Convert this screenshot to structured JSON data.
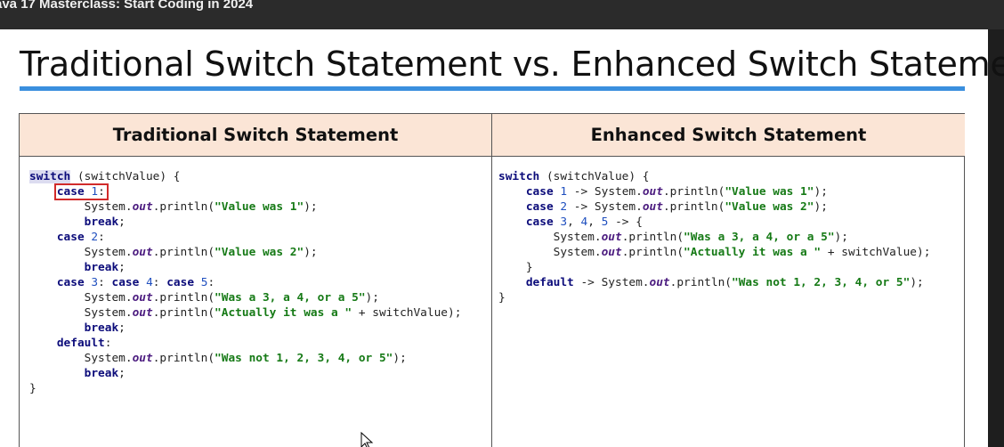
{
  "window": {
    "title": "ava 17 Masterclass: Start Coding in 2024"
  },
  "slide": {
    "title": "Traditional Switch Statement vs. Enhanced Switch Statement"
  },
  "table": {
    "left_header": "Traditional Switch Statement",
    "right_header": "Enhanced Switch Statement"
  },
  "traditional_code": [
    [
      [
        "switch",
        "kw hl-switch"
      ],
      [
        " (switchValue) {",
        ""
      ]
    ],
    [
      [
        "    ",
        ""
      ],
      [
        "case",
        "kw"
      ],
      [
        " ",
        ""
      ],
      [
        "1",
        "num"
      ],
      [
        ":",
        ""
      ]
    ],
    [
      [
        "        System.",
        ""
      ],
      [
        "out",
        "fld"
      ],
      [
        ".println(",
        ""
      ],
      [
        "\"Value was 1\"",
        "str"
      ],
      [
        ");",
        ""
      ]
    ],
    [
      [
        "        ",
        ""
      ],
      [
        "break",
        "kw"
      ],
      [
        ";",
        ""
      ]
    ],
    [
      [
        "    ",
        ""
      ],
      [
        "case",
        "kw"
      ],
      [
        " ",
        ""
      ],
      [
        "2",
        "num"
      ],
      [
        ":",
        ""
      ]
    ],
    [
      [
        "        System.",
        ""
      ],
      [
        "out",
        "fld"
      ],
      [
        ".println(",
        ""
      ],
      [
        "\"Value was 2\"",
        "str"
      ],
      [
        ");",
        ""
      ]
    ],
    [
      [
        "        ",
        ""
      ],
      [
        "break",
        "kw"
      ],
      [
        ";",
        ""
      ]
    ],
    [
      [
        "    ",
        ""
      ],
      [
        "case",
        "kw"
      ],
      [
        " ",
        ""
      ],
      [
        "3",
        "num"
      ],
      [
        ": ",
        ""
      ],
      [
        "case",
        "kw"
      ],
      [
        " ",
        ""
      ],
      [
        "4",
        "num"
      ],
      [
        ": ",
        ""
      ],
      [
        "case",
        "kw"
      ],
      [
        " ",
        ""
      ],
      [
        "5",
        "num"
      ],
      [
        ":",
        ""
      ]
    ],
    [
      [
        "        System.",
        ""
      ],
      [
        "out",
        "fld"
      ],
      [
        ".println(",
        ""
      ],
      [
        "\"Was a 3, a 4, or a 5\"",
        "str"
      ],
      [
        ");",
        ""
      ]
    ],
    [
      [
        "        System.",
        ""
      ],
      [
        "out",
        "fld"
      ],
      [
        ".println(",
        ""
      ],
      [
        "\"Actually it was a \"",
        "str"
      ],
      [
        " + switchValue);",
        ""
      ]
    ],
    [
      [
        "        ",
        ""
      ],
      [
        "break",
        "kw"
      ],
      [
        ";",
        ""
      ]
    ],
    [
      [
        "    ",
        ""
      ],
      [
        "default",
        "kw"
      ],
      [
        ":",
        ""
      ]
    ],
    [
      [
        "        System.",
        ""
      ],
      [
        "out",
        "fld"
      ],
      [
        ".println(",
        ""
      ],
      [
        "\"Was not 1, 2, 3, 4, or 5\"",
        "str"
      ],
      [
        ");",
        ""
      ]
    ],
    [
      [
        "        ",
        ""
      ],
      [
        "break",
        "kw"
      ],
      [
        ";",
        ""
      ]
    ],
    [
      [
        "}",
        ""
      ]
    ]
  ],
  "enhanced_code": [
    [
      [
        "switch",
        "kw"
      ],
      [
        " (switchValue) {",
        ""
      ]
    ],
    [
      [
        "    ",
        ""
      ],
      [
        "case",
        "kw"
      ],
      [
        " ",
        ""
      ],
      [
        "1",
        "num"
      ],
      [
        " -> System.",
        ""
      ],
      [
        "out",
        "fld"
      ],
      [
        ".println(",
        ""
      ],
      [
        "\"Value was 1\"",
        "str"
      ],
      [
        ");",
        ""
      ]
    ],
    [
      [
        "    ",
        ""
      ],
      [
        "case",
        "kw"
      ],
      [
        " ",
        ""
      ],
      [
        "2",
        "num"
      ],
      [
        " -> System.",
        ""
      ],
      [
        "out",
        "fld"
      ],
      [
        ".println(",
        ""
      ],
      [
        "\"Value was 2\"",
        "str"
      ],
      [
        ");",
        ""
      ]
    ],
    [
      [
        "    ",
        ""
      ],
      [
        "case",
        "kw"
      ],
      [
        " ",
        ""
      ],
      [
        "3",
        "num"
      ],
      [
        ", ",
        ""
      ],
      [
        "4",
        "num"
      ],
      [
        ", ",
        ""
      ],
      [
        "5",
        "num"
      ],
      [
        " -> {",
        ""
      ]
    ],
    [
      [
        "        System.",
        ""
      ],
      [
        "out",
        "fld"
      ],
      [
        ".println(",
        ""
      ],
      [
        "\"Was a 3, a 4, or a 5\"",
        "str"
      ],
      [
        ");",
        ""
      ]
    ],
    [
      [
        "        System.",
        ""
      ],
      [
        "out",
        "fld"
      ],
      [
        ".println(",
        ""
      ],
      [
        "\"Actually it was a \"",
        "str"
      ],
      [
        " + switchValue);",
        ""
      ]
    ],
    [
      [
        "    }",
        ""
      ]
    ],
    [
      [
        "    ",
        ""
      ],
      [
        "default",
        "kw"
      ],
      [
        " -> System.",
        ""
      ],
      [
        "out",
        "fld"
      ],
      [
        ".println(",
        ""
      ],
      [
        "\"Was not 1, 2, 3, 4, or 5\"",
        "str"
      ],
      [
        ");",
        ""
      ]
    ],
    [
      [
        "}",
        ""
      ]
    ]
  ],
  "colors": {
    "header_fill": "#fbe5d6",
    "title_rule": "#3a8fde",
    "highlight_box": "#d12b2b",
    "keyword": "#0b0b7a",
    "string": "#167a16"
  }
}
